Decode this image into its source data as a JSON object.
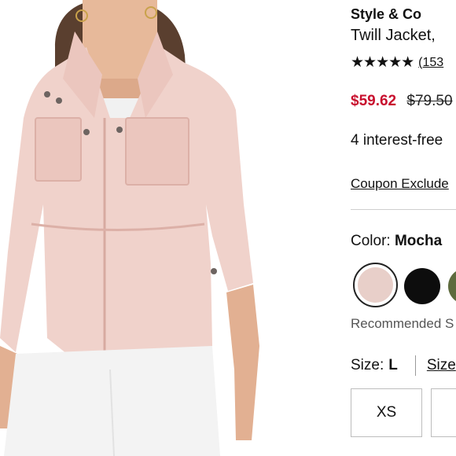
{
  "product": {
    "brand": "Style & Co",
    "name": "Twill Jacket,",
    "rating": {
      "stars": "★★★★★",
      "count": "(153"
    },
    "price": {
      "sale": "$59.62",
      "original": "$79.50"
    },
    "installment_text": "4 interest-free",
    "coupon_link": "Coupon Exclude"
  },
  "color": {
    "label": "Color:",
    "selected": "Mocha",
    "swatches": [
      {
        "name": "blush-swatch",
        "color": "#e8cfc9",
        "selected": true
      },
      {
        "name": "black-swatch",
        "color": "#0d0d0d",
        "selected": false
      },
      {
        "name": "olive-swatch",
        "color": "#5e6b3e",
        "selected": false
      }
    ],
    "recommended_text": "Recommended S"
  },
  "size": {
    "label": "Size:",
    "selected": "L",
    "guide_link": "Size",
    "options": [
      "XS",
      ""
    ]
  },
  "image": {
    "icon": "product-photo",
    "alt": ""
  }
}
